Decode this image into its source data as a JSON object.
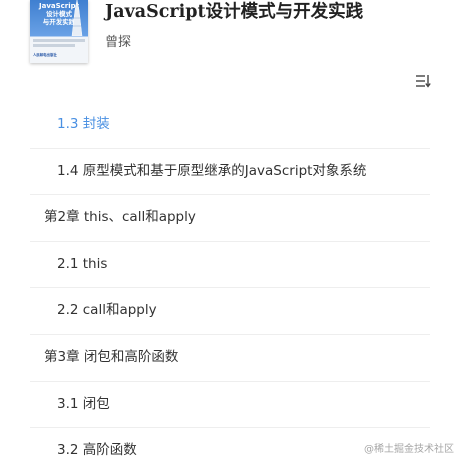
{
  "book": {
    "title": "JavaScript设计模式与开发实践",
    "author": "曾探",
    "cover": {
      "title_line1": "JavaScript",
      "title_line2": "设计模式",
      "title_line3": "与开发实践",
      "publisher": "人民邮电出版社"
    }
  },
  "toolbar": {
    "sort_icon": "sort-order-icon"
  },
  "toc": {
    "items": [
      {
        "label": "1.3 封装",
        "level": 2,
        "current": true
      },
      {
        "label": "1.4 原型模式和基于原型继承的JavaScript对象系统",
        "level": 2,
        "current": false
      },
      {
        "label": "第2章 this、call和apply",
        "level": 1,
        "current": false
      },
      {
        "label": "2.1 this",
        "level": 2,
        "current": false
      },
      {
        "label": "2.2 call和apply",
        "level": 2,
        "current": false
      },
      {
        "label": "第3章 闭包和高阶函数",
        "level": 1,
        "current": false
      },
      {
        "label": "3.1 闭包",
        "level": 2,
        "current": false
      },
      {
        "label": "3.2 高阶函数",
        "level": 2,
        "current": false
      }
    ]
  },
  "watermark": "@稀土掘金技术社区",
  "colors": {
    "accent": "#4a90e2",
    "text": "#333333",
    "divider": "#eeeeee"
  }
}
